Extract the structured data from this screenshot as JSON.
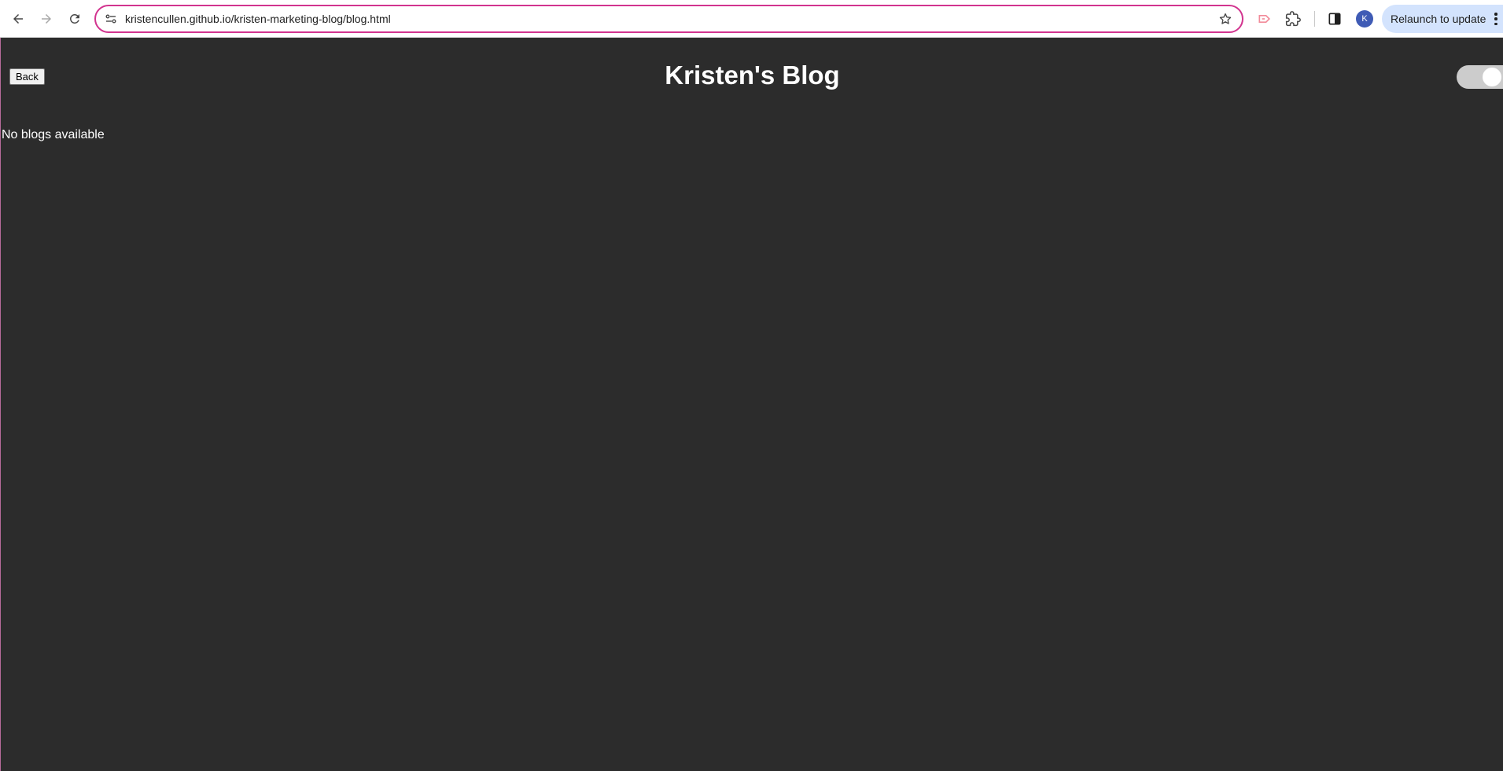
{
  "browser": {
    "url": "kristencullen.github.io/kristen-marketing-blog/blog.html",
    "profile_initial": "K",
    "relaunch_label": "Relaunch to update",
    "icons": {
      "back": "back-arrow-icon",
      "forward": "forward-arrow-icon",
      "reload": "reload-icon",
      "site_info": "site-info-icon",
      "bookmark": "star-icon",
      "cast": "cast-icon",
      "extensions": "puzzle-icon",
      "side_panel": "side-panel-icon",
      "menu": "kebab-menu-icon"
    },
    "colors": {
      "omnibox_border": "#d2348f",
      "relaunch_bg": "#d3e3fd",
      "avatar_bg": "#3f5bb5"
    }
  },
  "page": {
    "back_label": "Back",
    "title": "Kristen's Blog",
    "empty_message": "No blogs available",
    "theme_toggle_on": true,
    "colors": {
      "background": "#2c2c2c",
      "text": "#ffffff"
    }
  }
}
